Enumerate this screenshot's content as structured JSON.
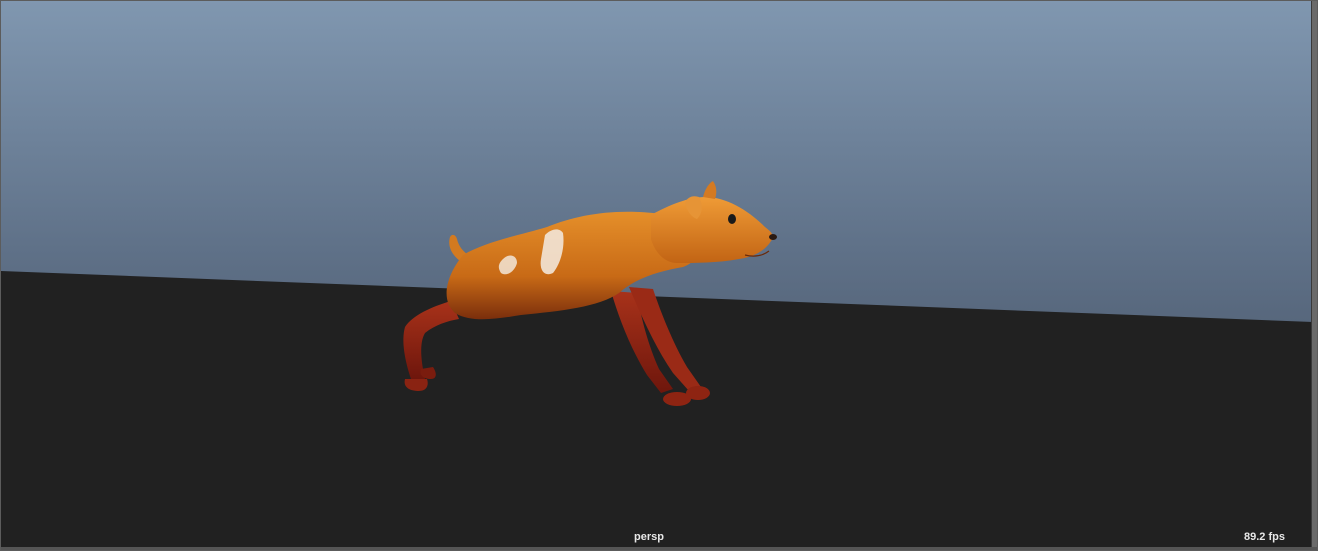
{
  "viewport": {
    "camera_name": "persp",
    "fps_readout": "89.2 fps",
    "sky_top_color": "#8097b0",
    "sky_bottom_color": "#3e4858",
    "ground_color": "#212121",
    "object": {
      "name": "dog",
      "body_color": "#d9801f",
      "legs_color": "#a8321a",
      "patch_color": "#f2e6d8"
    }
  }
}
